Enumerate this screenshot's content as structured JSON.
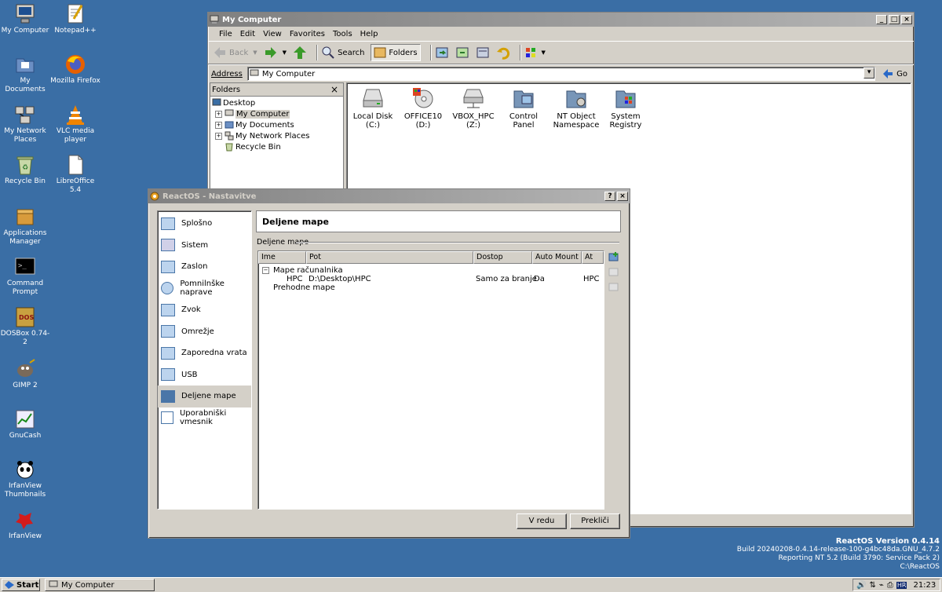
{
  "desktop": {
    "icons": [
      {
        "label": "My Computer",
        "icon": "computer-icon"
      },
      {
        "label": "Notepad++",
        "icon": "notepad-icon"
      },
      {
        "label": "My Documents",
        "icon": "documents-folder-icon"
      },
      {
        "label": "Mozilla Firefox",
        "icon": "firefox-icon"
      },
      {
        "label": "My Network Places",
        "icon": "network-icon"
      },
      {
        "label": "VLC media player",
        "icon": "vlc-cone-icon"
      },
      {
        "label": "Recycle Bin",
        "icon": "recycle-bin-icon"
      },
      {
        "label": "LibreOffice 5.4",
        "icon": "document-icon"
      },
      {
        "label": "Applications Manager",
        "icon": "package-icon"
      },
      {
        "label": "Command Prompt",
        "icon": "terminal-icon"
      },
      {
        "label": "DOSBox 0.74-2",
        "icon": "dosbox-icon"
      },
      {
        "label": "GIMP 2",
        "icon": "gimp-icon"
      },
      {
        "label": "GnuCash",
        "icon": "chart-icon"
      },
      {
        "label": "IrfanView Thumbnails",
        "icon": "panda-icon"
      },
      {
        "label": "IrfanView",
        "icon": "irfanview-icon"
      }
    ],
    "version": {
      "line1": "ReactOS Version 0.4.14",
      "line2": "Build 20240208-0.4.14-release-100-g4bc48da.GNU_4.7.2",
      "line3": "Reporting NT 5.2 (Build 3790: Service Pack 2)",
      "line4": "C:\\ReactOS"
    }
  },
  "explorer": {
    "title": "My Computer",
    "menu": [
      "File",
      "Edit",
      "View",
      "Favorites",
      "Tools",
      "Help"
    ],
    "toolbar": {
      "back": "Back",
      "search": "Search",
      "folders": "Folders"
    },
    "address": {
      "label": "Address",
      "value": "My Computer",
      "go": "Go"
    },
    "folders_pane": {
      "title": "Folders",
      "close": "×",
      "tree": [
        "Desktop",
        "My Computer",
        "My Documents",
        "My Network Places",
        "Recycle Bin"
      ]
    },
    "items": [
      {
        "label": "Local Disk (C:)",
        "icon": "hard-disk-icon"
      },
      {
        "label": "OFFICE10 (D:)",
        "icon": "cd-drive-icon"
      },
      {
        "label": "VBOX_HPC (Z:)",
        "icon": "network-drive-icon"
      },
      {
        "label": "Control Panel",
        "icon": "control-panel-icon"
      },
      {
        "label": "NT Object Namespace",
        "icon": "object-namespace-icon"
      },
      {
        "label": "System Registry",
        "icon": "registry-icon"
      }
    ]
  },
  "dialog": {
    "title": "ReactOS - Nastavitve",
    "help": "?",
    "close": "×",
    "nav": [
      "Splošno",
      "Sistem",
      "Zaslon",
      "Pomnilnške naprave",
      "Zvok",
      "Omrežje",
      "Zaporedna vrata",
      "USB",
      "Deljene mape",
      "Uporabniški vmesnik"
    ],
    "selected": "Deljene mape",
    "header": "Deljene mape",
    "group_label": "Deljene mape",
    "columns": [
      "Ime",
      "Pot",
      "Dostop",
      "Auto Mount",
      "At"
    ],
    "tree": {
      "machine": "Mape računalnika",
      "row": {
        "name": "HPC",
        "path": "D:\\Desktop\\HPC",
        "access": "Samo za branje",
        "auto": "Da",
        "at": "HPC"
      },
      "transient": "Prehodne mape"
    },
    "ok": "V redu",
    "cancel": "Prekliči"
  },
  "taskbar": {
    "start": "Start",
    "task": "My Computer",
    "lang": "HR",
    "time": "21:23"
  }
}
